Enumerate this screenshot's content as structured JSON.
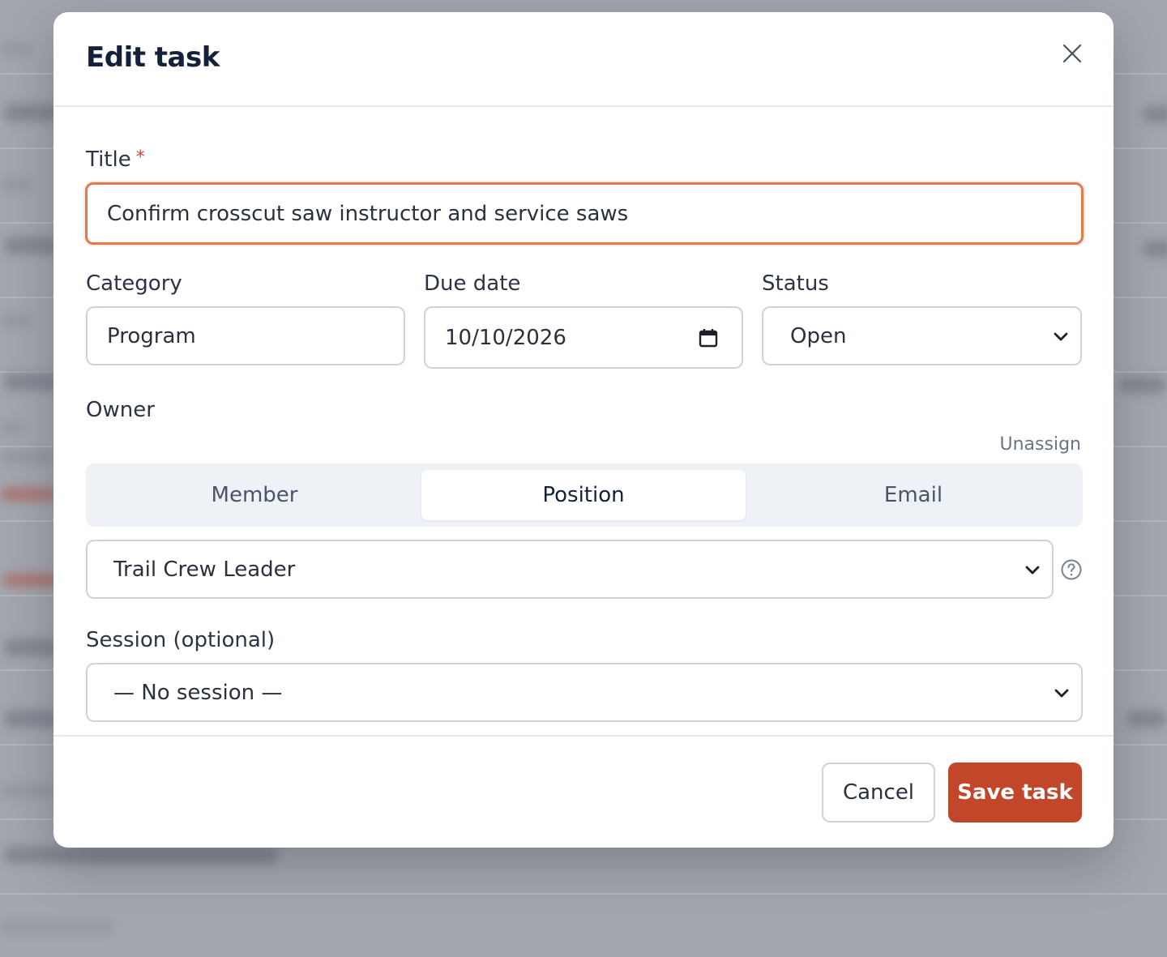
{
  "modal": {
    "title": "Edit task"
  },
  "form": {
    "title_label": "Title",
    "title_required_mark": "*",
    "title_value": "Confirm crosscut saw instructor and service saws",
    "category_label": "Category",
    "category_value": "Program",
    "due_date_label": "Due date",
    "due_date_value": "10/10/2026",
    "status_label": "Status",
    "status_value": "Open",
    "owner_label": "Owner",
    "unassign_link": "Unassign",
    "owner_tabs": [
      "Member",
      "Position",
      "Email"
    ],
    "owner_active_tab": "Position",
    "position_value": "Trail Crew Leader",
    "session_label": "Session (optional)",
    "session_value": "— No session —"
  },
  "footer": {
    "cancel_label": "Cancel",
    "save_label": "Save task"
  },
  "colors": {
    "accent": "#c1462a",
    "focus_border": "#e07a4f",
    "required": "#d6452f"
  },
  "icons": {
    "close": "close-icon",
    "calendar": "calendar-icon",
    "chevron": "chevron-down-icon",
    "help": "help-circle-icon"
  }
}
